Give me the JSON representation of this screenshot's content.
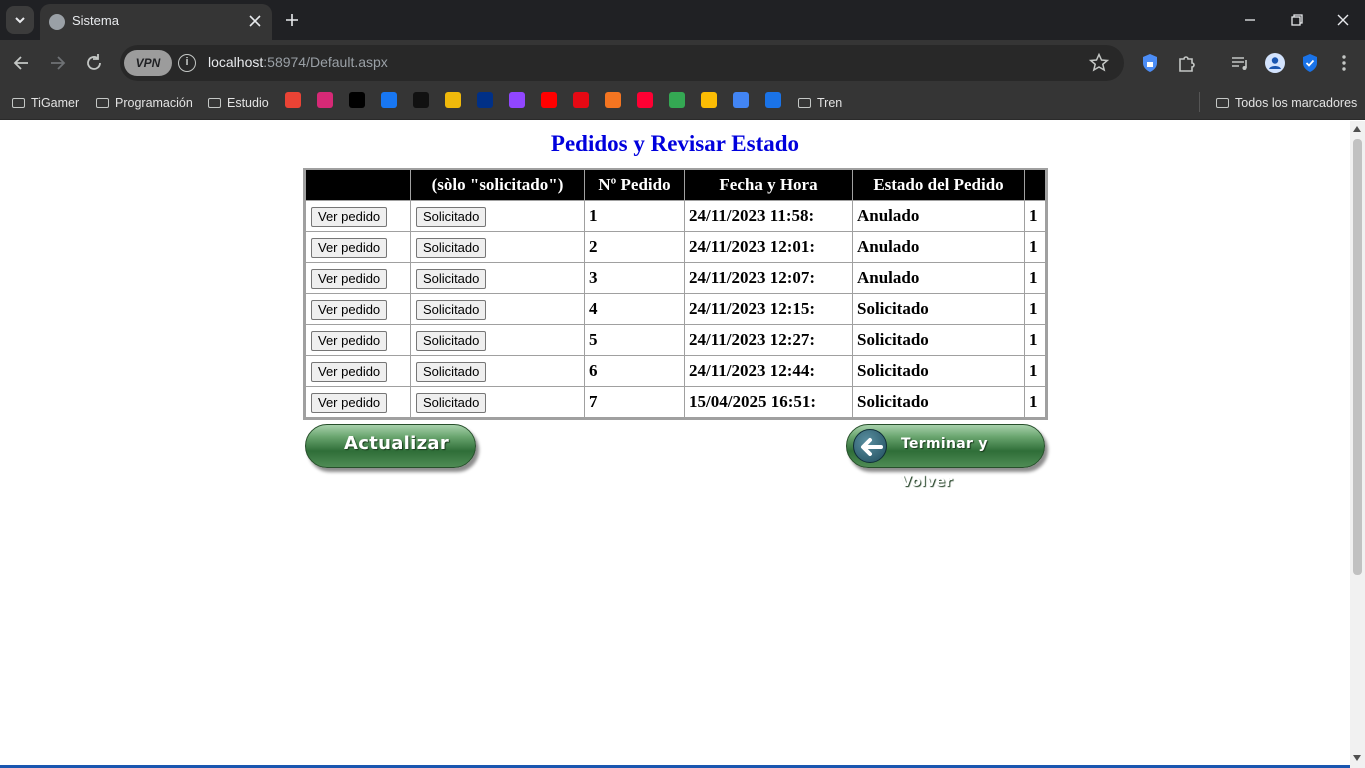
{
  "browser": {
    "tab_title": "Sistema",
    "vpn_label": "VPN",
    "url_host": "localhost",
    "url_rest": ":58974/Default.aspx",
    "bookmarks": [
      {
        "label": "TiGamer",
        "type": "folder"
      },
      {
        "label": "Programación",
        "type": "folder"
      },
      {
        "label": "Estudio",
        "type": "folder"
      },
      {
        "label": "Tren",
        "type": "folder"
      }
    ],
    "all_bookmarks_label": "Todos los marcadores",
    "bookmark_icons": [
      {
        "name": "gmail-icon",
        "color": "#ea4335"
      },
      {
        "name": "instagram-icon",
        "color": "#d62976"
      },
      {
        "name": "x-icon",
        "color": "#000000"
      },
      {
        "name": "facebook-icon",
        "color": "#1877f2"
      },
      {
        "name": "tiktok-icon",
        "color": "#111111"
      },
      {
        "name": "binance-icon",
        "color": "#f0b90b"
      },
      {
        "name": "paypal-icon",
        "color": "#003087"
      },
      {
        "name": "twitch-icon",
        "color": "#9146ff"
      },
      {
        "name": "youtube-icon",
        "color": "#ff0000"
      },
      {
        "name": "netflix-icon",
        "color": "#e50914"
      },
      {
        "name": "crunchyroll-icon",
        "color": "#f47521"
      },
      {
        "name": "youtube-music-icon",
        "color": "#ff0033"
      },
      {
        "name": "maps-icon",
        "color": "#34a853"
      },
      {
        "name": "drive-icon",
        "color": "#fbbc04"
      },
      {
        "name": "translate-icon",
        "color": "#4285f4"
      },
      {
        "name": "media-player-icon",
        "color": "#1a73e8"
      }
    ]
  },
  "page": {
    "title": "Pedidos y Revisar Estado",
    "table": {
      "headers": [
        "",
        "(sòlo \"solicitado\")",
        "Nº Pedido",
        "Fecha y Hora",
        "Estado del Pedido",
        ""
      ],
      "rows": [
        {
          "view": "Ver pedido",
          "action": "Solicitado",
          "num": "1",
          "fecha": "24/11/2023 11:58:",
          "estado": "Anulado",
          "extra": "1"
        },
        {
          "view": "Ver pedido",
          "action": "Solicitado",
          "num": "2",
          "fecha": "24/11/2023 12:01:",
          "estado": "Anulado",
          "extra": "1"
        },
        {
          "view": "Ver pedido",
          "action": "Solicitado",
          "num": "3",
          "fecha": "24/11/2023 12:07:",
          "estado": "Anulado",
          "extra": "1"
        },
        {
          "view": "Ver pedido",
          "action": "Solicitado",
          "num": "4",
          "fecha": "24/11/2023 12:15:",
          "estado": "Solicitado",
          "extra": "1"
        },
        {
          "view": "Ver pedido",
          "action": "Solicitado",
          "num": "5",
          "fecha": "24/11/2023 12:27:",
          "estado": "Solicitado",
          "extra": "1"
        },
        {
          "view": "Ver pedido",
          "action": "Solicitado",
          "num": "6",
          "fecha": "24/11/2023 12:44:",
          "estado": "Solicitado",
          "extra": "1"
        },
        {
          "view": "Ver pedido",
          "action": "Solicitado",
          "num": "7",
          "fecha": "15/04/2025 16:51:",
          "estado": "Solicitado",
          "extra": "1"
        }
      ]
    },
    "refresh_label": "Actualizar",
    "back_label": "Terminar y Volver"
  }
}
